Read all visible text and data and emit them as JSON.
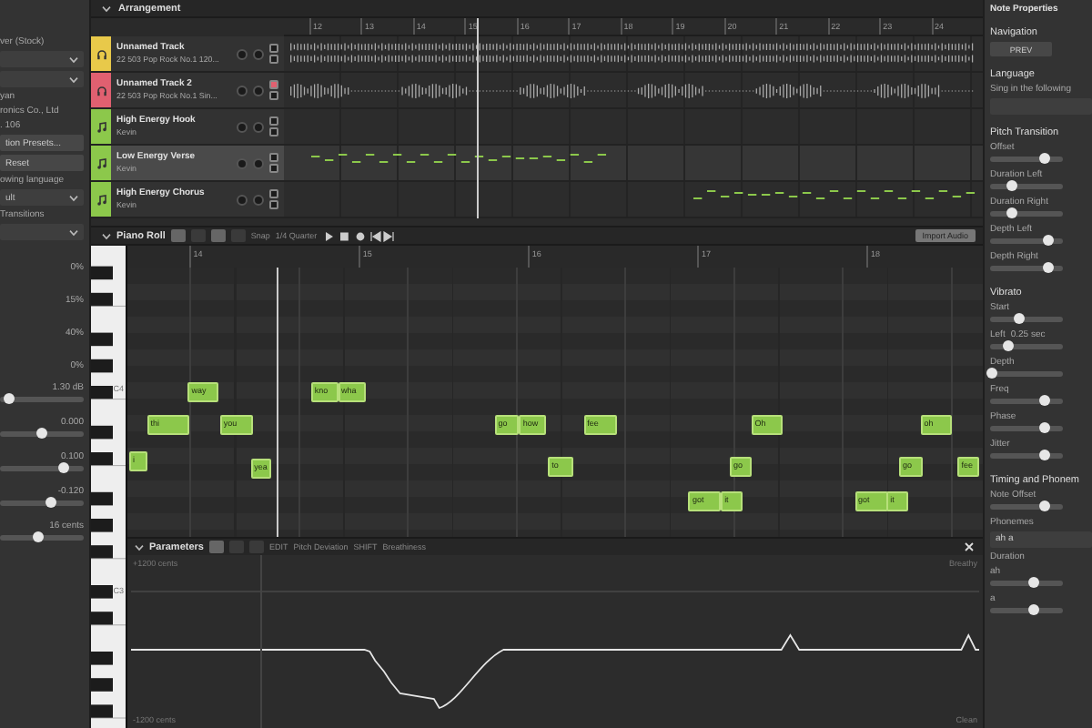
{
  "left_panel": {
    "items": [
      {
        "kind": "label",
        "text": "ver (Stock)"
      },
      {
        "kind": "dropdown"
      },
      {
        "kind": "dropdown"
      },
      {
        "kind": "label",
        "text": "yan"
      },
      {
        "kind": "label",
        "text": "ronics Co., Ltd"
      },
      {
        "kind": "label",
        "text": ". 106"
      },
      {
        "kind": "button",
        "text": "tion Presets..."
      },
      {
        "kind": "button",
        "text": "Reset"
      },
      {
        "kind": "label",
        "text": "owing language"
      },
      {
        "kind": "dropdown",
        "text": "ult"
      },
      {
        "kind": "label",
        "text": "Transitions"
      },
      {
        "kind": "dropdown"
      },
      {
        "kind": "value",
        "text": "0%"
      },
      {
        "kind": "value",
        "text": "15%"
      },
      {
        "kind": "value",
        "text": "40%"
      },
      {
        "kind": "value",
        "text": "0%"
      },
      {
        "kind": "slider",
        "text": "1.30 dB",
        "level": 0.1
      },
      {
        "kind": "slider",
        "text": "0.000",
        "level": 0.5
      },
      {
        "kind": "slider",
        "text": "0.100",
        "level": 0.75
      },
      {
        "kind": "slider",
        "text": "-0.120",
        "level": 0.6
      },
      {
        "kind": "slider",
        "text": "16 cents",
        "level": 0.45
      }
    ]
  },
  "arrangement": {
    "title": "Arrangement",
    "bars": [
      "12",
      "13",
      "14",
      "15",
      "16",
      "17",
      "18",
      "19",
      "20",
      "21",
      "22",
      "23",
      "24"
    ],
    "tracks": [
      {
        "name": "Unnamed Track",
        "voice": "22 503 Pop Rock No.1 120...",
        "kind": "audio",
        "color": "#e8c94a",
        "muted": false,
        "selected": false
      },
      {
        "name": "Unnamed Track 2",
        "voice": "22 503 Pop Rock No.1 Sin...",
        "kind": "audio",
        "color": "#e06070",
        "muted": true,
        "selected": false
      },
      {
        "name": "High Energy Hook",
        "voice": "Kevin",
        "kind": "vocal",
        "color": "#8cc84b",
        "muted": false,
        "selected": false
      },
      {
        "name": "Low Energy Verse",
        "voice": "Kevin",
        "kind": "vocal",
        "color": "#8cc84b",
        "muted": false,
        "selected": true
      },
      {
        "name": "High Energy Chorus",
        "voice": "Kevin",
        "kind": "vocal",
        "color": "#8cc84b",
        "muted": false,
        "selected": false
      }
    ]
  },
  "piano_roll": {
    "title": "Piano Roll",
    "snap_label": "Snap",
    "snap_value": "1/4 Quarter",
    "import_button": "Import Audio",
    "bars": [
      "14",
      "15",
      "16",
      "17",
      "18"
    ],
    "key_labels": [
      "C4",
      "C3"
    ],
    "notes": [
      {
        "lyric": "i"
      },
      {
        "lyric": "thi"
      },
      {
        "lyric": "way"
      },
      {
        "lyric": "you"
      },
      {
        "lyric": "yea"
      },
      {
        "lyric": "kno"
      },
      {
        "lyric": "wha"
      },
      {
        "lyric": "go"
      },
      {
        "lyric": "how"
      },
      {
        "lyric": "to"
      },
      {
        "lyric": "fee"
      },
      {
        "lyric": "got"
      },
      {
        "lyric": "it"
      },
      {
        "lyric": "go"
      },
      {
        "lyric": "Oh"
      },
      {
        "lyric": "got"
      },
      {
        "lyric": "it"
      },
      {
        "lyric": "go"
      },
      {
        "lyric": "oh"
      },
      {
        "lyric": "fee"
      }
    ]
  },
  "parameters": {
    "title": "Parameters",
    "edit_label": "EDIT",
    "edit_value": "Pitch Deviation",
    "shift_label": "SHIFT",
    "shift_value": "Breathiness",
    "top_left": "+1200 cents",
    "bottom_left": "-1200 cents",
    "top_right": "Breathy",
    "bottom_right": "Clean"
  },
  "note_properties": {
    "title": "Note Properties",
    "items": [
      {
        "kind": "section",
        "text": "Navigation"
      },
      {
        "kind": "button",
        "text": "PREV"
      },
      {
        "kind": "section",
        "text": "Language"
      },
      {
        "kind": "label",
        "text": "Sing in the following"
      },
      {
        "kind": "field"
      },
      {
        "kind": "section",
        "text": "Pitch Transition"
      },
      {
        "kind": "slider",
        "text": "Offset",
        "level": 0.75
      },
      {
        "kind": "slider",
        "text": "Duration Left",
        "level": 0.3
      },
      {
        "kind": "slider",
        "text": "Duration Right",
        "level": 0.3
      },
      {
        "kind": "slider",
        "text": "Depth Left",
        "level": 0.8
      },
      {
        "kind": "slider",
        "text": "Depth Right",
        "level": 0.8
      },
      {
        "kind": "section",
        "text": "Vibrato"
      },
      {
        "kind": "slider",
        "text": "Start",
        "level": 0.4
      },
      {
        "kind": "slider",
        "text": "Left",
        "value": "0.25 sec",
        "level": 0.25
      },
      {
        "kind": "slider",
        "text": "Depth",
        "level": 0.03
      },
      {
        "kind": "slider",
        "text": "Freq",
        "level": 0.75
      },
      {
        "kind": "slider",
        "text": "Phase",
        "level": 0.75
      },
      {
        "kind": "slider",
        "text": "Jitter",
        "level": 0.75
      },
      {
        "kind": "section",
        "text": "Timing and Phonem"
      },
      {
        "kind": "slider",
        "text": "Note Offset",
        "level": 0.75
      },
      {
        "kind": "label",
        "text": "Phonemes"
      },
      {
        "kind": "field",
        "text": "ah a"
      },
      {
        "kind": "label",
        "text": "Duration"
      },
      {
        "kind": "slider",
        "text": "ah",
        "level": 0.6
      },
      {
        "kind": "slider",
        "text": "a",
        "level": 0.6
      }
    ]
  }
}
